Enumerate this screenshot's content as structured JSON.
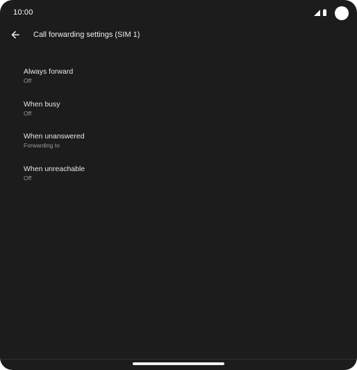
{
  "status_bar": {
    "time": "10:00",
    "signal_icon": "signal-icon",
    "battery_icon": "battery-icon"
  },
  "app_bar": {
    "back_icon": "arrow-back-icon",
    "title": "Call forwarding settings (SIM 1)"
  },
  "settings": [
    {
      "label": "Always forward",
      "value": "Off"
    },
    {
      "label": "When busy",
      "value": "Off"
    },
    {
      "label": "When unanswered",
      "value": "Forwarding to"
    },
    {
      "label": "When unreachable",
      "value": "Off"
    }
  ],
  "colors": {
    "background": "#1c1c1c",
    "primary_text": "#e8e8e8",
    "secondary_text": "#9a9a9a",
    "handle": "#f2f2f2"
  }
}
